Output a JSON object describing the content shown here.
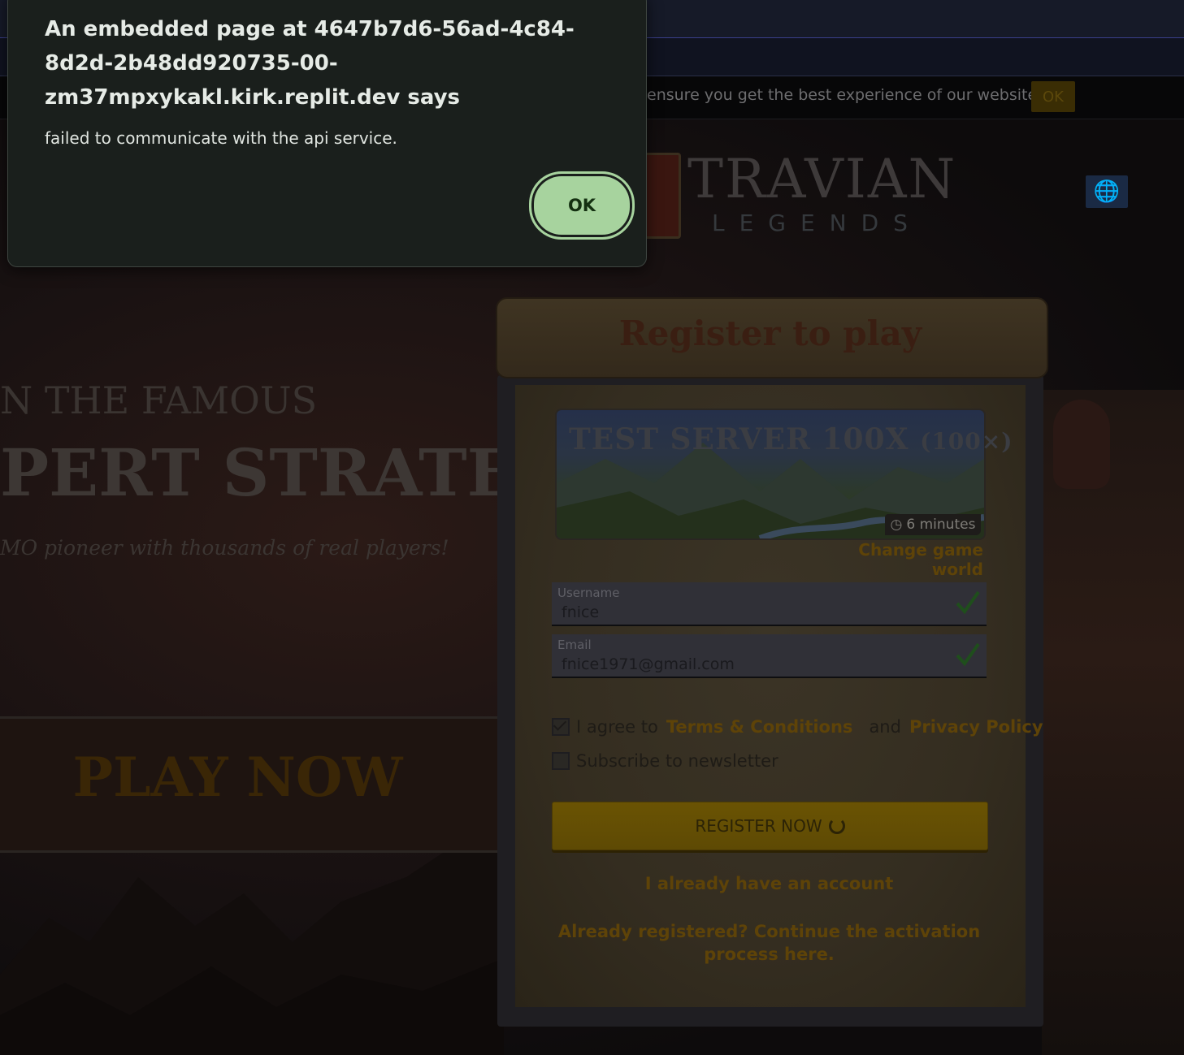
{
  "cookie_bar": {
    "text": "ensure you get the best experience of our website.",
    "ok_label": "OK"
  },
  "logo": {
    "title": "TRAVIAN",
    "subtitle": "LEGENDS"
  },
  "hero": {
    "line1": "N THE FAMOUS",
    "line2": "PERT STRATEGY",
    "line3": "MO pioneer with thousands of real players!",
    "play_label": "PLAY NOW"
  },
  "register": {
    "title": "Register to play",
    "server": {
      "name": "TEST SERVER 100X",
      "speed": "(100×)",
      "time": "6 minutes"
    },
    "change_world": "Change game world",
    "username": {
      "label": "Username",
      "value": "fnice"
    },
    "email": {
      "label": "Email",
      "value": "fnice1971@gmail.com"
    },
    "agree": {
      "prefix": "I agree to",
      "terms": "Terms & Conditions",
      "and": "and",
      "privacy": "Privacy Policy",
      "checked": true
    },
    "newsletter": {
      "label": "Subscribe to newsletter",
      "checked": false
    },
    "register_button": "REGISTER NOW",
    "have_account": "I already have an account",
    "activation": "Already registered? Continue the activation process here."
  },
  "dialog": {
    "title": "An embedded page at 4647b7d6-56ad-4c84-8d2d-2b48dd920735-00-zm37mpxykakl.kirk.replit.dev says",
    "message": "failed to communicate with the api service.",
    "ok_label": "OK"
  },
  "colors": {
    "accent_gold": "#5e4308",
    "check_green": "#1f7a1f",
    "dialog_button": "#a7d39e"
  }
}
